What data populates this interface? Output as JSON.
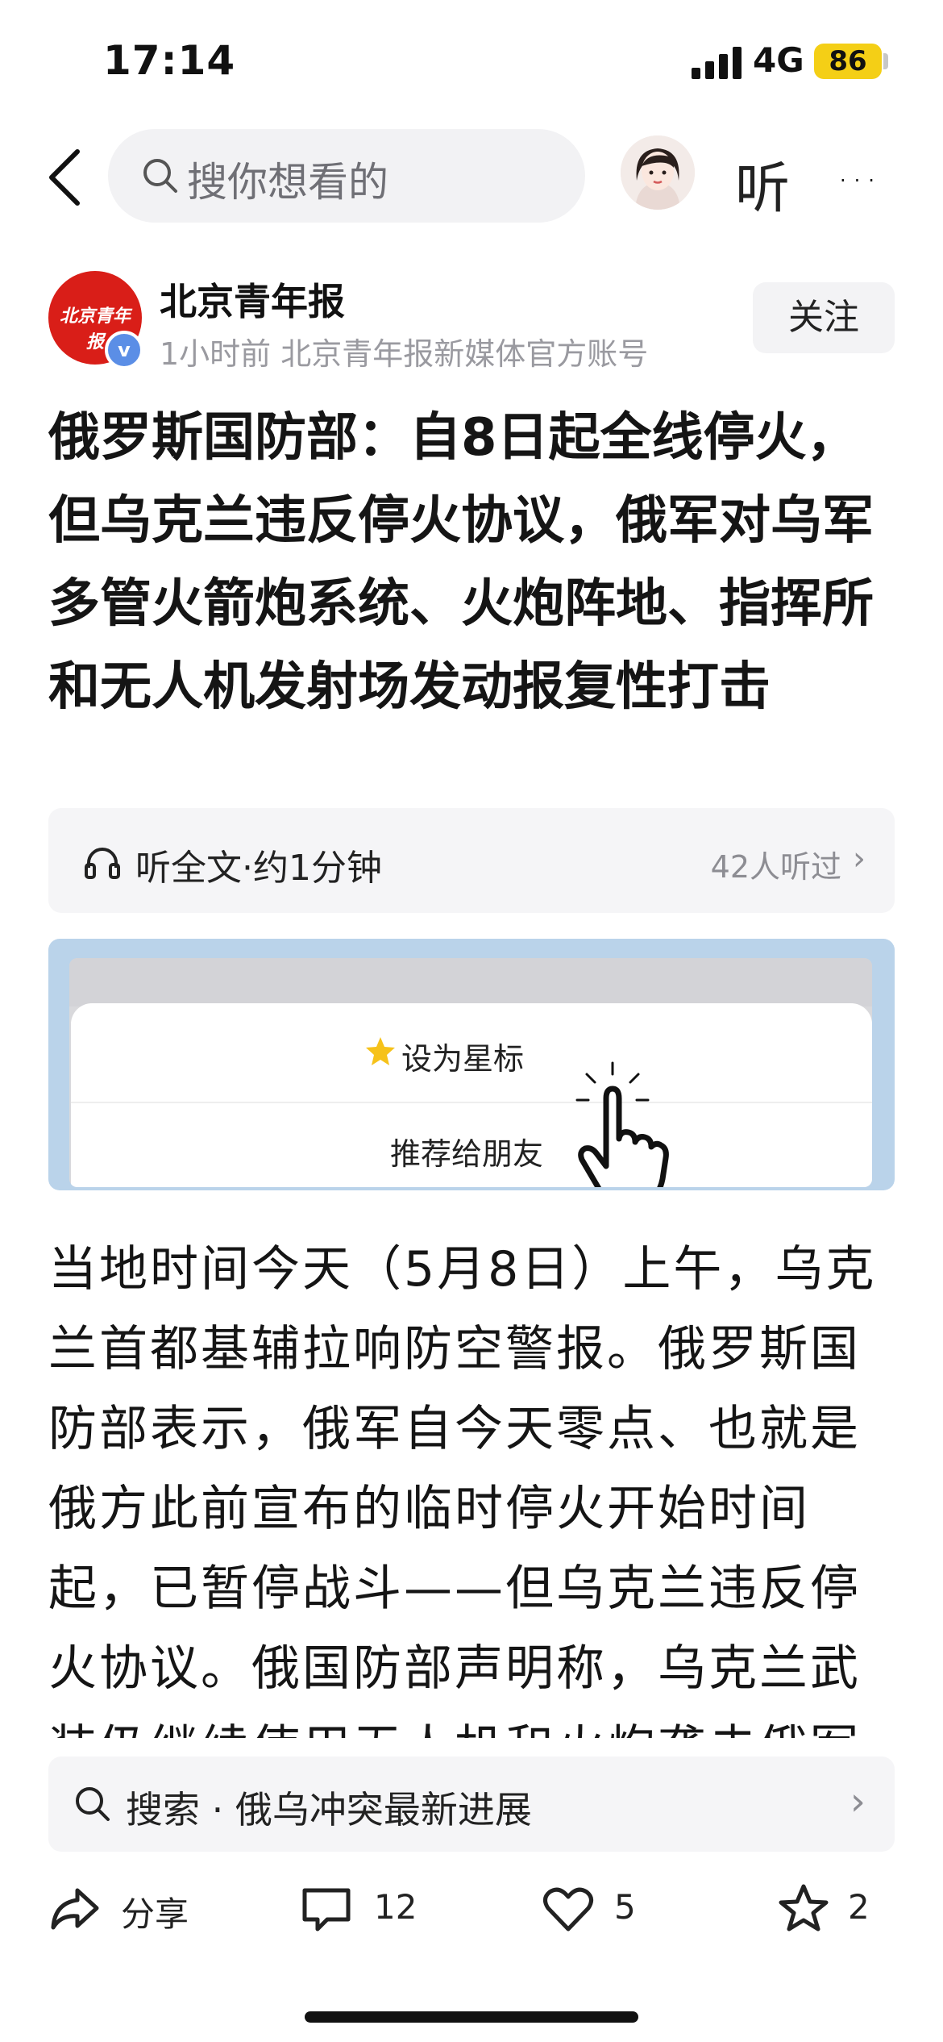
{
  "status_bar": {
    "time": "17:14",
    "network": "4G",
    "battery": "86"
  },
  "nav": {
    "search_placeholder": "搜你想看的",
    "listen_label": "听",
    "more_label": "···"
  },
  "account": {
    "logo_text": "北京青年报",
    "name": "北京青年报",
    "meta": "1小时前  北京青年报新媒体官方账号",
    "follow_label": "关注"
  },
  "article": {
    "headline": "俄罗斯国防部：自8日起全线停火，但乌克兰违反停火协议，俄军对乌军多管火箭炮系统、火炮阵地、指挥所和无人机发射场发动报复性打击",
    "body": "当地时间今天（5月8日）上午，乌克兰首都基辅拉响防空警报。俄罗斯国防部表示，俄军自今天零点、也就是俄方此前宣布的临时停火开始时间起，已暂停战斗——但乌克兰违反停火协议。俄国防部声明称，乌克兰武装仍继续使用无人机和火炮袭击俄军"
  },
  "audio": {
    "label": "听全文·约1分钟",
    "listeners": "42人听过",
    "arrow": "›"
  },
  "embed": {
    "star_label": "设为星标",
    "recommend_label": "推荐给朋友"
  },
  "suggestion": {
    "text": "搜索 · 俄乌冲突最新进展",
    "arrow": "›"
  },
  "actions": {
    "share": "分享",
    "comments": "12",
    "likes": "5",
    "favorites": "2"
  },
  "colors": {
    "accent_red": "#d91e18",
    "battery_yellow": "#f4cf16",
    "verify_blue": "#5b8ee6",
    "embed_blue": "#bad3ea"
  }
}
